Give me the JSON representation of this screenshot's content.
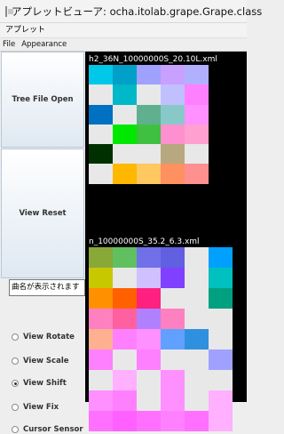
{
  "window": {
    "title": "アプレットビューア: ocha.itolab.grape.Grape.class"
  },
  "applet_menu": {
    "label": "アプレット"
  },
  "menubar": {
    "file": "File",
    "appearance": "Appearance"
  },
  "sidebar": {
    "tree_open": "Tree File Open",
    "view_reset": "View Reset",
    "name_field": "曲名が表示されます",
    "radios": [
      {
        "label": "View Rotate",
        "selected": false
      },
      {
        "label": "View Scale",
        "selected": false
      },
      {
        "label": "View Shift",
        "selected": true
      },
      {
        "label": "View Fix",
        "selected": false
      },
      {
        "label": "Cursor Sensor",
        "selected": false
      }
    ]
  },
  "canvas": {
    "label1": "h2_36N_10000000S_20.10L.xml",
    "label2": "n_10000000S_35.2_6.3.xml",
    "grid1_colors": [
      "#00c8e8",
      "#00a0c8",
      "#a0a0ff",
      "#c8a0ff",
      "#b0b0ff",
      "#e8e8e8",
      "#00b8c8",
      "#e8e8e8",
      "#c0c0ff",
      "#ff80ff",
      "#0070c0",
      "#e8e8e8",
      "#60b090",
      "#88c8c8",
      "#ff90ff",
      "#e8e8e8",
      "#00e800",
      "#40c040",
      "#ff90d0",
      "#ffa0d0",
      "#003000",
      "#e8e8e8",
      "#e8e8e8",
      "#b8a880",
      "#e8e8e8",
      "#e8e8e8",
      "#ffb800",
      "#ffc860",
      "#ff9060",
      "#ff9090"
    ],
    "grid2_colors": [
      "#88a838",
      "#60c060",
      "#7070e8",
      "#6060e0",
      "#e8e8e8",
      "#00a0ff",
      "#c8c800",
      "#e8e8e8",
      "#d0c0ff",
      "#8040ff",
      "#e8e8e8",
      "#00c0c0",
      "#ff9000",
      "#ff6000",
      "#ff2080",
      "#e8e8e8",
      "#e8e8e8",
      "#00a080",
      "#ff80c0",
      "#ff60a0",
      "#b080ff",
      "#ff80c0",
      "#e8e8e8",
      "#e8e8e8",
      "#ffb090",
      "#ff80ff",
      "#ff90ff",
      "#60a0ff",
      "#3090e0",
      "#e8e8e8",
      "#ff80ff",
      "#e8e8e8",
      "#ff80ff",
      "#e8e8e8",
      "#e8e8e8",
      "#a0a0ff",
      "#e8e8e8",
      "#ffb0ff",
      "#e8e8e8",
      "#ff90ff",
      "#e8e8e8",
      "#e8e8e8",
      "#ff90ff",
      "#ff80ff",
      "#e8e8e8",
      "#ff90ff",
      "#e8e8e8",
      "#ffb0ff",
      "#ff70ff",
      "#ff60ff",
      "#ff70ff",
      "#ff80ff",
      "#ff70ff",
      "#ffb0ff"
    ]
  }
}
